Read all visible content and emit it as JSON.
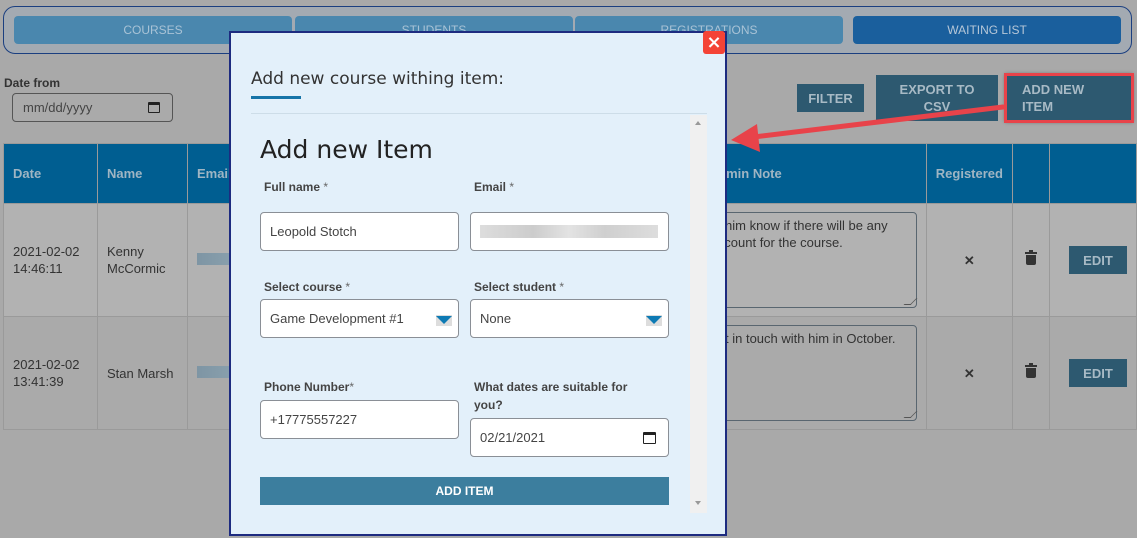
{
  "nav": {
    "tabs": [
      {
        "label": "COURSES",
        "active": false
      },
      {
        "label": "STUDENTS",
        "active": false
      },
      {
        "label": "REGISTRATIONS",
        "active": false
      },
      {
        "label": "WAITING LIST",
        "active": true
      }
    ]
  },
  "filter": {
    "date_from_label": "Date from",
    "date_from_placeholder": "mm/dd/yyyy",
    "filter_button": "FILTER",
    "export_button_line1": "EXPORT TO",
    "export_button_line2": "CSV",
    "add_new_line1": "ADD NEW",
    "add_new_line2": "ITEM"
  },
  "table": {
    "headers": [
      "Date",
      "Name",
      "Email",
      "Admin Note",
      "Registered",
      "",
      ""
    ],
    "rows": [
      {
        "date": "2021-02-02",
        "time": "14:46:11",
        "name": "Kenny McCormic",
        "note_line1": "t him know if there will be any",
        "note_line2": "scount for the course.",
        "registered": "✕",
        "edit": "EDIT"
      },
      {
        "date": "2021-02-02",
        "time": "13:41:39",
        "name": "Stan Marsh",
        "note_line1": "et in touch with him in October.",
        "note_line2": "",
        "registered": "✕",
        "edit": "EDIT"
      }
    ]
  },
  "modal": {
    "title": "Add new course withing item:",
    "close_icon": "×",
    "form_heading": "Add new Item",
    "fields": {
      "full_name_label": "Full name",
      "full_name_value": "Leopold Stotch",
      "email_label": "Email",
      "course_label": "Select course",
      "course_value": "Game Development #1",
      "student_label": "Select student",
      "student_value": "None",
      "phone_label": "Phone Number",
      "phone_value": "+17775557227",
      "dates_label_line1": "What dates are suitable for",
      "dates_label_line2": "you?",
      "dates_value": "02/21/2021",
      "required_mark": "*"
    },
    "submit": "ADD ITEM"
  },
  "colors": {
    "accent": "#005e91",
    "button_dark": "#2d5970",
    "close_red": "#f44336",
    "annotation_red": "#e8434a"
  }
}
